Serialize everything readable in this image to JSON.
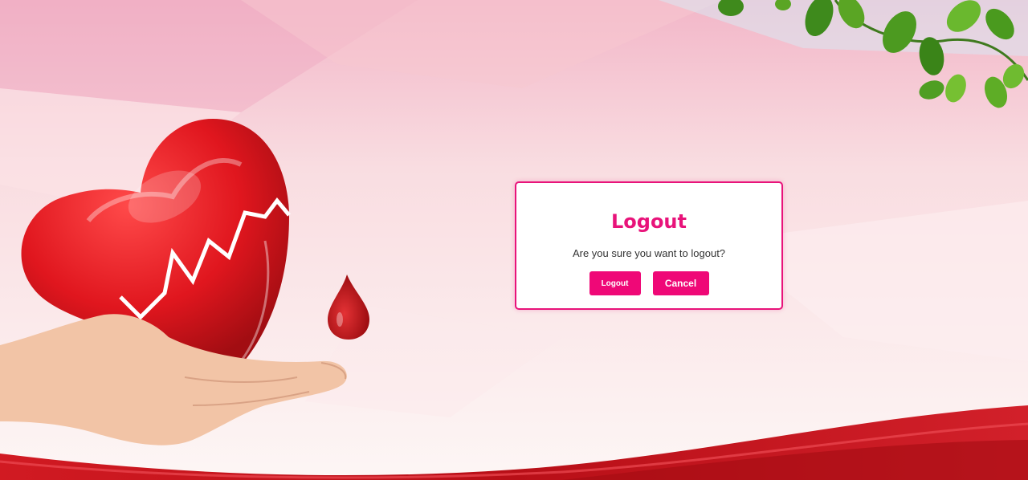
{
  "dialog": {
    "title": "Logout",
    "message": "Are you sure you want to logout?",
    "confirm_label": "Logout",
    "cancel_label": "Cancel"
  },
  "colors": {
    "accent": "#e8137a",
    "button": "#ef0877",
    "heart": "#e0161e",
    "ribbon": "#c8141c"
  },
  "illustration": {
    "icons": [
      "heart-icon",
      "blood-drop-icon",
      "hand-icon",
      "leaves-icon"
    ]
  }
}
